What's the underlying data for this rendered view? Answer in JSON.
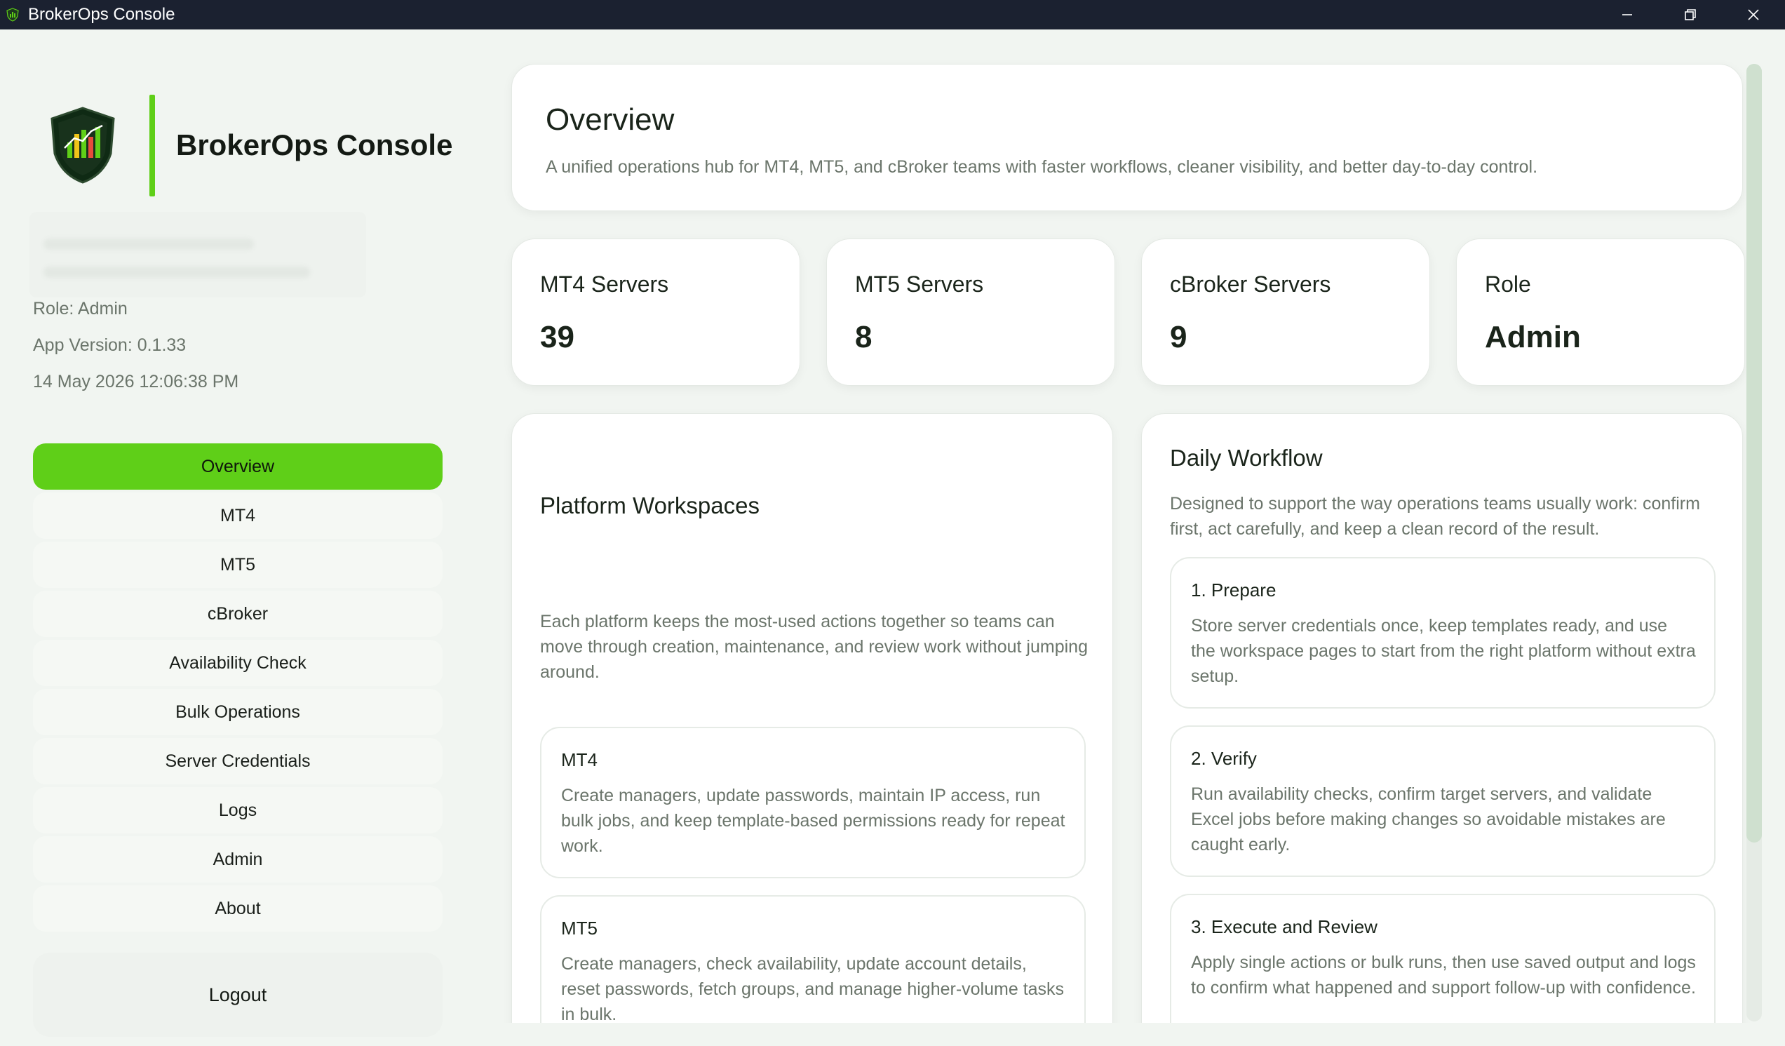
{
  "window": {
    "title": "BrokerOps Console"
  },
  "sidebar": {
    "brand": "BrokerOps Console",
    "role": "Role: Admin",
    "version": "App Version: 0.1.33",
    "datetime": "14 May 2026 12:06:38 PM",
    "nav": [
      {
        "label": "Overview",
        "active": true
      },
      {
        "label": "MT4"
      },
      {
        "label": "MT5"
      },
      {
        "label": "cBroker"
      },
      {
        "label": "Availability Check"
      },
      {
        "label": "Bulk Operations"
      },
      {
        "label": "Server Credentials"
      },
      {
        "label": "Logs"
      },
      {
        "label": "Admin"
      },
      {
        "label": "About"
      }
    ],
    "logout": "Logout"
  },
  "overview": {
    "title": "Overview",
    "subtitle": "A unified operations hub for MT4, MT5, and cBroker teams with faster workflows, cleaner visibility, and better day-to-day control."
  },
  "stats": [
    {
      "label": "MT4 Servers",
      "value": "39"
    },
    {
      "label": "MT5 Servers",
      "value": "8"
    },
    {
      "label": "cBroker Servers",
      "value": "9"
    },
    {
      "label": "Role",
      "value": "Admin"
    }
  ],
  "workspaces": {
    "title": "Platform Workspaces",
    "description": "Each platform keeps the most-used actions together so teams can move through creation, maintenance, and review work without jumping around.",
    "items": [
      {
        "title": "MT4",
        "text": "Create managers, update passwords, maintain IP access, run bulk jobs, and keep template-based permissions ready for repeat work."
      },
      {
        "title": "MT5",
        "text": "Create managers, check availability, update account details, reset passwords, fetch groups, and manage higher-volume tasks in bulk."
      }
    ]
  },
  "workflow": {
    "title": "Daily Workflow",
    "description": "Designed to support the way operations teams usually work: confirm first, act carefully, and keep a clean record of the result.",
    "steps": [
      {
        "title": "1. Prepare",
        "text": "Store server credentials once, keep templates ready, and use the workspace pages to start from the right platform without extra setup."
      },
      {
        "title": "2. Verify",
        "text": "Run availability checks, confirm target servers, and validate Excel jobs before making changes so avoidable mistakes are caught early."
      },
      {
        "title": "3. Execute and Review",
        "text": "Apply single actions or bulk runs, then use saved output and logs to confirm what happened and support follow-up with confidence."
      }
    ]
  },
  "colors": {
    "accent": "#5fcf18",
    "titlebar": "#1b2130"
  }
}
